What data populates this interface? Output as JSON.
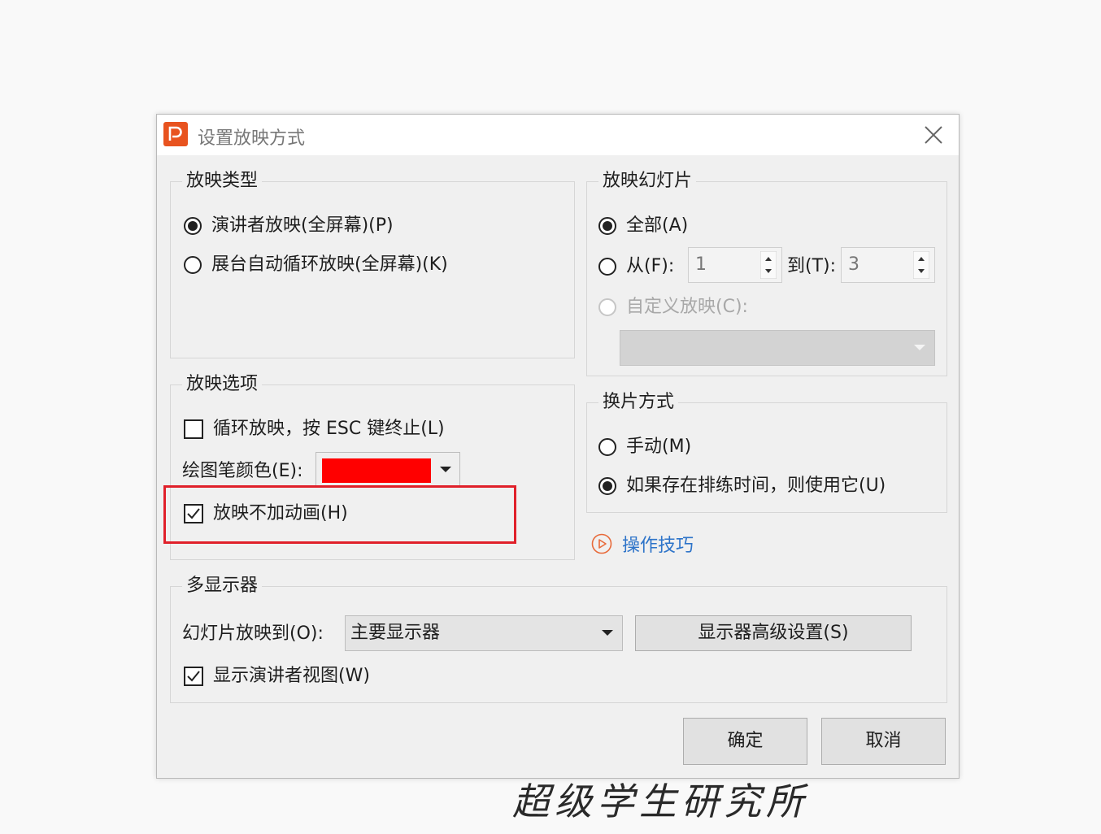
{
  "dialog": {
    "title": "设置放映方式",
    "icon": "wps-presentation-icon",
    "show_type": {
      "legend": "放映类型",
      "options": [
        {
          "label": "演讲者放映(全屏幕)(P)",
          "selected": true
        },
        {
          "label": "展台自动循环放映(全屏幕)(K)",
          "selected": false
        }
      ]
    },
    "show_slides": {
      "legend": "放映幻灯片",
      "all_label": "全部(A)",
      "from_label": "从(F):",
      "from_value": "1",
      "to_label": "到(T):",
      "to_value": "3",
      "custom_label": "自定义放映(C):",
      "selection": "all"
    },
    "show_options": {
      "legend": "放映选项",
      "loop_label": "循环放映，按 ESC 键终止(L)",
      "loop_checked": false,
      "pen_color_label": "绘图笔颜色(E):",
      "pen_color": "#ff0000",
      "no_animation_label": "放映不加动画(H)",
      "no_animation_checked": true
    },
    "advance": {
      "legend": "换片方式",
      "manual_label": "手动(M)",
      "timings_label": "如果存在排练时间，则使用它(U)",
      "selection": "timings"
    },
    "tips_link": "操作技巧",
    "multi_monitor": {
      "legend": "多显示器",
      "show_on_label": "幻灯片放映到(O):",
      "show_on_value": "主要显示器",
      "advanced_button": "显示器高级设置(S)",
      "presenter_view_label": "显示演讲者视图(W)",
      "presenter_view_checked": true
    },
    "ok_button": "确定",
    "cancel_button": "取消"
  },
  "watermark": "超级学生研究所",
  "colors": {
    "accent": "#e8531f",
    "highlight": "#e0202a",
    "link": "#2e74c9"
  }
}
